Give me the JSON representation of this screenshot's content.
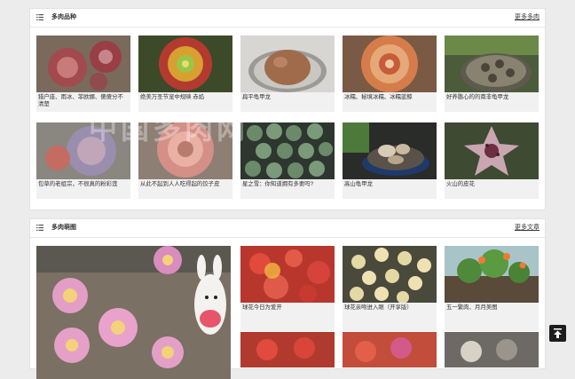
{
  "section_varieties": {
    "title": "多肉品种",
    "more_label": "更多多肉",
    "cards": [
      {
        "caption": "猎户座、雨冰、菲欧娜、傻傻分不清楚"
      },
      {
        "caption": "绝美万圣节宠中规映 赤焰"
      },
      {
        "caption": "扁平龟甲龙"
      },
      {
        "caption": "冰糯、秘境冰糯、冰糯蓝鲸"
      },
      {
        "caption": "好养憨心的的南非龟甲龙"
      },
      {
        "caption": "包草的老组宗，不很真的粉彩莲"
      },
      {
        "caption": "从此不起到人人吃得起的饺子皮"
      },
      {
        "caption": "星之雪：你知道拥有多要吗?"
      },
      {
        "caption": "高山龟甲龙"
      },
      {
        "caption": "火山的皮花"
      }
    ]
  },
  "section_cute": {
    "title": "多肉萌图",
    "more_label": "更多文章",
    "cards": [
      {
        "caption": ""
      },
      {
        "caption": "球花今日为爱开"
      },
      {
        "caption": "球花亲吻进入眼（开享版）"
      },
      {
        "caption": "五一繁肉、月月美图"
      }
    ]
  },
  "watermark_text": "中国多肉网",
  "back_to_top_icon": "arrow-up-icon"
}
